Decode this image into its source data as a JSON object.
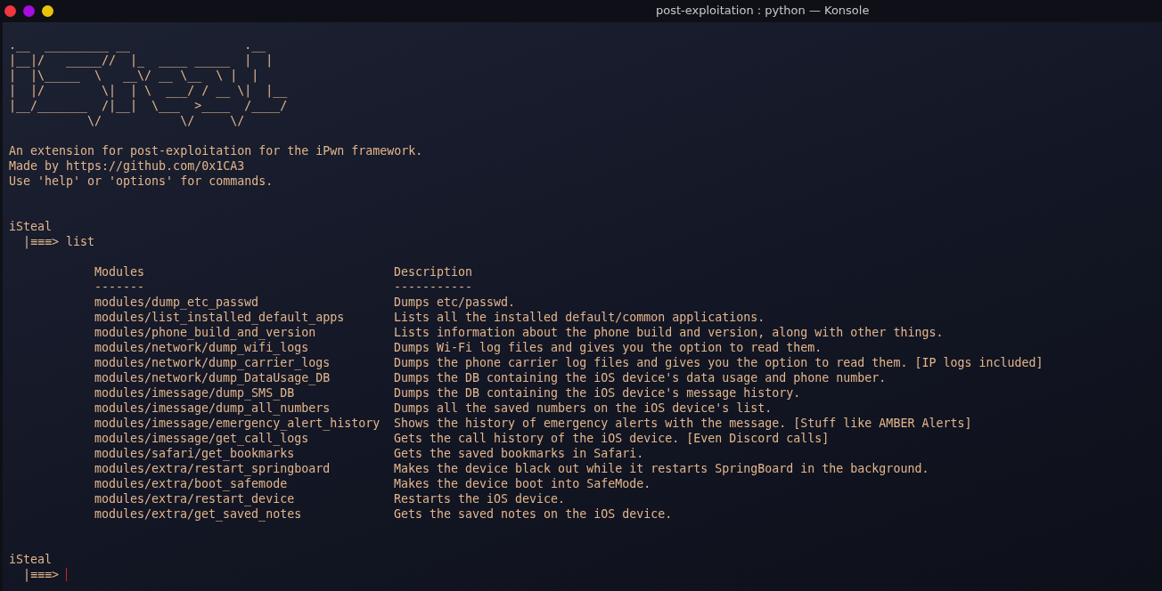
{
  "window": {
    "title": "post-exploitation : python — Konsole"
  },
  "banner_art": [
    ".__  _________ __                .__",
    "|__|/   _____//  |_  ____ _____  |  |",
    "|  |\\_____  \\   __\\/ __ \\__  \\ |  |",
    "|  |/        \\|  | \\  ___/ / __ \\|  |__",
    "|__/_______  /|__|  \\___  >____  /____/",
    "           \\/           \\/     \\/"
  ],
  "intro": [
    "An extension for post-exploitation for the iPwn framework.",
    "Made by https://github.com/0x1CA3",
    "Use 'help' or 'options' for commands."
  ],
  "sessions": [
    {
      "prompt_name": "iSteal",
      "prompt_arrow": "|≡≡≡>",
      "command": "list",
      "output": {
        "columns": [
          "Modules",
          "Description"
        ],
        "underlines": [
          "-------",
          "-----------"
        ],
        "rows": [
          [
            "modules/dump_etc_passwd",
            "Dumps etc/passwd."
          ],
          [
            "modules/list_installed_default_apps",
            "Lists all the installed default/common applications."
          ],
          [
            "modules/phone_build_and_version",
            "Lists information about the phone build and version, along with other things."
          ],
          [
            "modules/network/dump_wifi_logs",
            "Dumps Wi-Fi log files and gives you the option to read them."
          ],
          [
            "modules/network/dump_carrier_logs",
            "Dumps the phone carrier log files and gives you the option to read them. [IP logs included]"
          ],
          [
            "modules/network/dump_DataUsage_DB",
            "Dumps the DB containing the iOS device's data usage and phone number."
          ],
          [
            "modules/imessage/dump_SMS_DB",
            "Dumps the DB containing the iOS device's message history."
          ],
          [
            "modules/imessage/dump_all_numbers",
            "Dumps all the saved numbers on the iOS device's list."
          ],
          [
            "modules/imessage/emergency_alert_history",
            "Shows the history of emergency alerts with the message. [Stuff like AMBER Alerts]"
          ],
          [
            "modules/imessage/get_call_logs",
            "Gets the call history of the iOS device. [Even Discord calls]"
          ],
          [
            "modules/safari/get_bookmarks",
            "Gets the saved bookmarks in Safari."
          ],
          [
            "modules/extra/restart_springboard",
            "Makes the device black out while it restarts SpringBoard in the background."
          ],
          [
            "modules/extra/boot_safemode",
            "Makes the device boot into SafeMode."
          ],
          [
            "modules/extra/restart_device",
            "Restarts the iOS device."
          ],
          [
            "modules/extra/get_saved_notes",
            "Gets the saved notes on the iOS device."
          ]
        ]
      }
    },
    {
      "prompt_name": "iSteal",
      "prompt_arrow": "|≡≡≡>",
      "cursor": true
    }
  ]
}
